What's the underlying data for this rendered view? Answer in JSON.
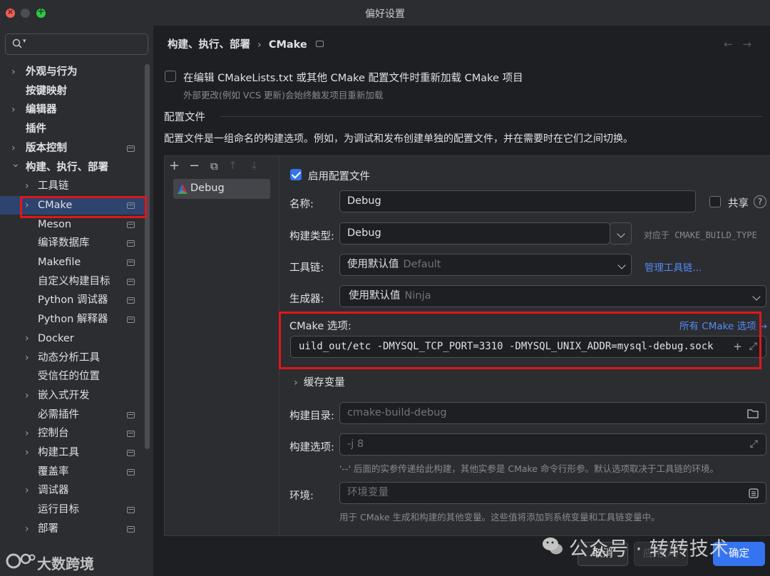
{
  "window": {
    "title": "偏好设置"
  },
  "search": {
    "placeholder": ""
  },
  "sidebar": {
    "items": [
      {
        "label": "外观与行为",
        "chevron": true,
        "indent": 0,
        "bold": true,
        "page_icon": false
      },
      {
        "label": "按键映射",
        "chevron": false,
        "indent": 0,
        "bold": true,
        "page_icon": false
      },
      {
        "label": "编辑器",
        "chevron": true,
        "indent": 0,
        "bold": true,
        "page_icon": false
      },
      {
        "label": "插件",
        "chevron": false,
        "indent": 0,
        "bold": true,
        "page_icon": false
      },
      {
        "label": "版本控制",
        "chevron": true,
        "indent": 0,
        "bold": true,
        "page_icon": true
      },
      {
        "label": "构建、执行、部署",
        "chevron": true,
        "expanded": true,
        "indent": 0,
        "bold": true,
        "page_icon": false
      },
      {
        "label": "工具链",
        "chevron": true,
        "indent": 1,
        "page_icon": false
      },
      {
        "label": "CMake",
        "chevron": true,
        "indent": 1,
        "page_icon": true,
        "selected": true
      },
      {
        "label": "Meson",
        "chevron": false,
        "indent": 1,
        "page_icon": true
      },
      {
        "label": "编译数据库",
        "chevron": false,
        "indent": 1,
        "page_icon": true
      },
      {
        "label": "Makefile",
        "chevron": false,
        "indent": 1,
        "page_icon": true
      },
      {
        "label": "自定义构建目标",
        "chevron": false,
        "indent": 1,
        "page_icon": true
      },
      {
        "label": "Python 调试器",
        "chevron": false,
        "indent": 1,
        "page_icon": true
      },
      {
        "label": "Python 解释器",
        "chevron": false,
        "indent": 1,
        "page_icon": true
      },
      {
        "label": "Docker",
        "chevron": true,
        "indent": 1,
        "page_icon": false
      },
      {
        "label": "动态分析工具",
        "chevron": true,
        "indent": 1,
        "page_icon": false
      },
      {
        "label": "受信任的位置",
        "chevron": false,
        "indent": 1,
        "page_icon": false
      },
      {
        "label": "嵌入式开发",
        "chevron": true,
        "indent": 1,
        "page_icon": false
      },
      {
        "label": "必需插件",
        "chevron": false,
        "indent": 1,
        "page_icon": true
      },
      {
        "label": "控制台",
        "chevron": true,
        "indent": 1,
        "page_icon": true
      },
      {
        "label": "构建工具",
        "chevron": true,
        "indent": 1,
        "page_icon": true
      },
      {
        "label": "覆盖率",
        "chevron": false,
        "indent": 1,
        "page_icon": true
      },
      {
        "label": "调试器",
        "chevron": true,
        "indent": 1,
        "page_icon": false
      },
      {
        "label": "运行目标",
        "chevron": false,
        "indent": 1,
        "page_icon": true
      },
      {
        "label": "部署",
        "chevron": true,
        "indent": 1,
        "page_icon": true
      }
    ]
  },
  "breadcrumb": {
    "parent": "构建、执行、部署",
    "separator": "›",
    "current": "CMake"
  },
  "reload": {
    "label": "在编辑 CMakeLists.txt 或其他 CMake 配置文件时重新加载 CMake 项目",
    "hint": "外部更改(例如 VCS 更新)会始终触发项目重新加载",
    "checked": false
  },
  "profiles_section": {
    "title": "配置文件",
    "description": "配置文件是一组命名的构建选项。例如，为调试和发布创建单独的配置文件，并在需要时在它们之间切换。",
    "toolbar": {
      "add": "+",
      "remove": "−",
      "copy": "⧉",
      "up": "⤒",
      "down": "⤓"
    },
    "items": [
      {
        "label": "Debug"
      }
    ]
  },
  "detail": {
    "enable_label": "启用配置文件",
    "enable_checked": true,
    "name_label": "名称:",
    "name_value": "Debug",
    "share_label": "共享",
    "share_checked": false,
    "help_glyph": "?",
    "build_type_label": "构建类型:",
    "build_type_value": "Debug",
    "build_type_hint": "对应于 CMAKE_BUILD_TYPE",
    "toolchain_label": "工具链:",
    "toolchain_value": "使用默认值",
    "toolchain_dim": "Default",
    "toolchain_link": "管理工具链...",
    "generator_label": "生成器:",
    "generator_value": "使用默认值",
    "generator_dim": "Ninja",
    "cmake_options_label": "CMake 选项:",
    "cmake_options_link": "所有 CMake 选项 →",
    "cmake_options_value": "uild_out/etc -DMYSQL_TCP_PORT=3310 -DMYSQL_UNIX_ADDR=mysql-debug.sock",
    "cache_vars_label": "缓存变量",
    "build_dir_label": "构建目录:",
    "build_dir_placeholder": "cmake-build-debug",
    "build_opts_label": "构建选项:",
    "build_opts_placeholder": "-j 8",
    "build_opts_hint": "'--' 后面的实参传递给此构建，其他实参是 CMake 命令行形参。默认选项取决于工具链的环境。",
    "env_label": "环境:",
    "env_placeholder": "环境变量",
    "env_hint": "用于 CMake 生成和构建的其他变量。这些值将添加到系统变量和工具链变量中。"
  },
  "buttons": {
    "cancel": "取消",
    "apply": "应用(A)",
    "ok": "确定"
  },
  "watermarks": {
    "wechat": "公众号 · 转转技术",
    "brand": "大数跨境"
  },
  "colors": {
    "accent": "#3574f0",
    "highlight": "#e0161a",
    "link": "#548af7",
    "selection": "#2e436e"
  }
}
